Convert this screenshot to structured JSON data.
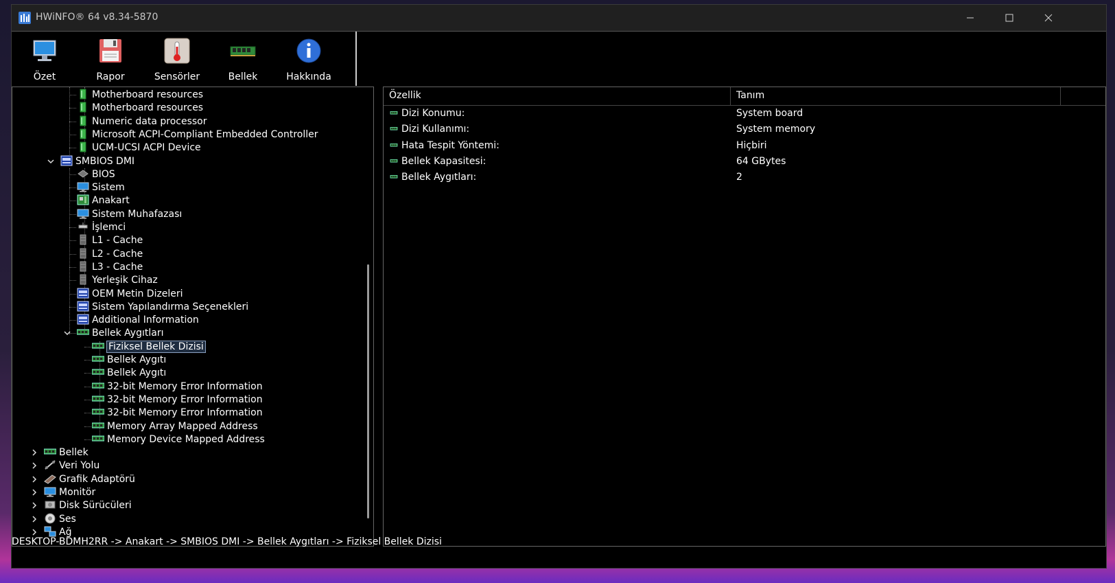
{
  "window": {
    "title": "HWiNFO® 64 v8.34-5870"
  },
  "toolbar": {
    "buttons": [
      {
        "label": "Özet",
        "icon": "monitor-icon"
      },
      {
        "label": "Rapor",
        "icon": "floppy-disk-icon"
      },
      {
        "label": "Sensörler",
        "icon": "thermometer-icon"
      },
      {
        "label": "Bellek",
        "icon": "ram-icon"
      },
      {
        "label": "Hakkında",
        "icon": "info-icon"
      }
    ]
  },
  "tree": {
    "items": [
      {
        "label": "Motherboard resources",
        "icon": "device-icon"
      },
      {
        "label": "Motherboard resources",
        "icon": "device-icon"
      },
      {
        "label": "Numeric data processor",
        "icon": "device-icon"
      },
      {
        "label": "Microsoft ACPI-Compliant Embedded Controller",
        "icon": "device-icon"
      },
      {
        "label": "UCM-UCSI ACPI Device",
        "icon": "device-icon"
      },
      {
        "label": "SMBIOS DMI",
        "icon": "dmi-icon"
      },
      {
        "label": "BIOS",
        "icon": "chip-icon"
      },
      {
        "label": "Sistem",
        "icon": "monitor-icon"
      },
      {
        "label": "Anakart",
        "icon": "motherboard-icon"
      },
      {
        "label": "Sistem Muhafazası",
        "icon": "monitor-icon"
      },
      {
        "label": "İşlemci",
        "icon": "cpu-icon"
      },
      {
        "label": "L1 - Cache",
        "icon": "cache-icon"
      },
      {
        "label": "L2 - Cache",
        "icon": "cache-icon"
      },
      {
        "label": "L3 - Cache",
        "icon": "cache-icon"
      },
      {
        "label": "Yerleşik Cihaz",
        "icon": "cache-icon"
      },
      {
        "label": "OEM Metin Dizeleri",
        "icon": "dmi-icon"
      },
      {
        "label": "Sistem Yapılandırma Seçenekleri",
        "icon": "dmi-icon"
      },
      {
        "label": "Additional Information",
        "icon": "dmi-icon"
      },
      {
        "label": "Bellek Aygıtları",
        "icon": "ram-icon"
      },
      {
        "label": "Fiziksel Bellek Dizisi",
        "icon": "ram-icon"
      },
      {
        "label": "Bellek Aygıtı",
        "icon": "ram-icon"
      },
      {
        "label": "Bellek Aygıtı",
        "icon": "ram-icon"
      },
      {
        "label": "32-bit Memory Error Information",
        "icon": "ram-icon"
      },
      {
        "label": "32-bit Memory Error Information",
        "icon": "ram-icon"
      },
      {
        "label": "32-bit Memory Error Information",
        "icon": "ram-icon"
      },
      {
        "label": "Memory Array Mapped Address",
        "icon": "ram-icon"
      },
      {
        "label": "Memory Device Mapped Address",
        "icon": "ram-icon"
      },
      {
        "label": "Bellek",
        "icon": "ram-icon"
      },
      {
        "label": "Veri Yolu",
        "icon": "bus-icon"
      },
      {
        "label": "Grafik Adaptörü",
        "icon": "gpu-icon"
      },
      {
        "label": "Monitör",
        "icon": "monitor-icon"
      },
      {
        "label": "Disk Sürücüleri",
        "icon": "disk-icon"
      },
      {
        "label": "Ses",
        "icon": "speaker-icon"
      },
      {
        "label": "Ağ",
        "icon": "network-icon"
      }
    ]
  },
  "details": {
    "col_property": "Özellik",
    "col_value": "Tanım",
    "rows": [
      {
        "key": "Dizi Konumu:",
        "value": "System board"
      },
      {
        "key": "Dizi Kullanımı:",
        "value": "System memory"
      },
      {
        "key": "Hata Tespit Yöntemi:",
        "value": "Hiçbiri"
      },
      {
        "key": "Bellek Kapasitesi:",
        "value": "64 GBytes"
      },
      {
        "key": "Bellek Aygıtları:",
        "value": "2"
      }
    ]
  },
  "status": {
    "path": "DESKTOP-BDMH2RR -> Anakart -> SMBIOS DMI -> Bellek Aygıtları -> Fiziksel Bellek Dizisi"
  }
}
